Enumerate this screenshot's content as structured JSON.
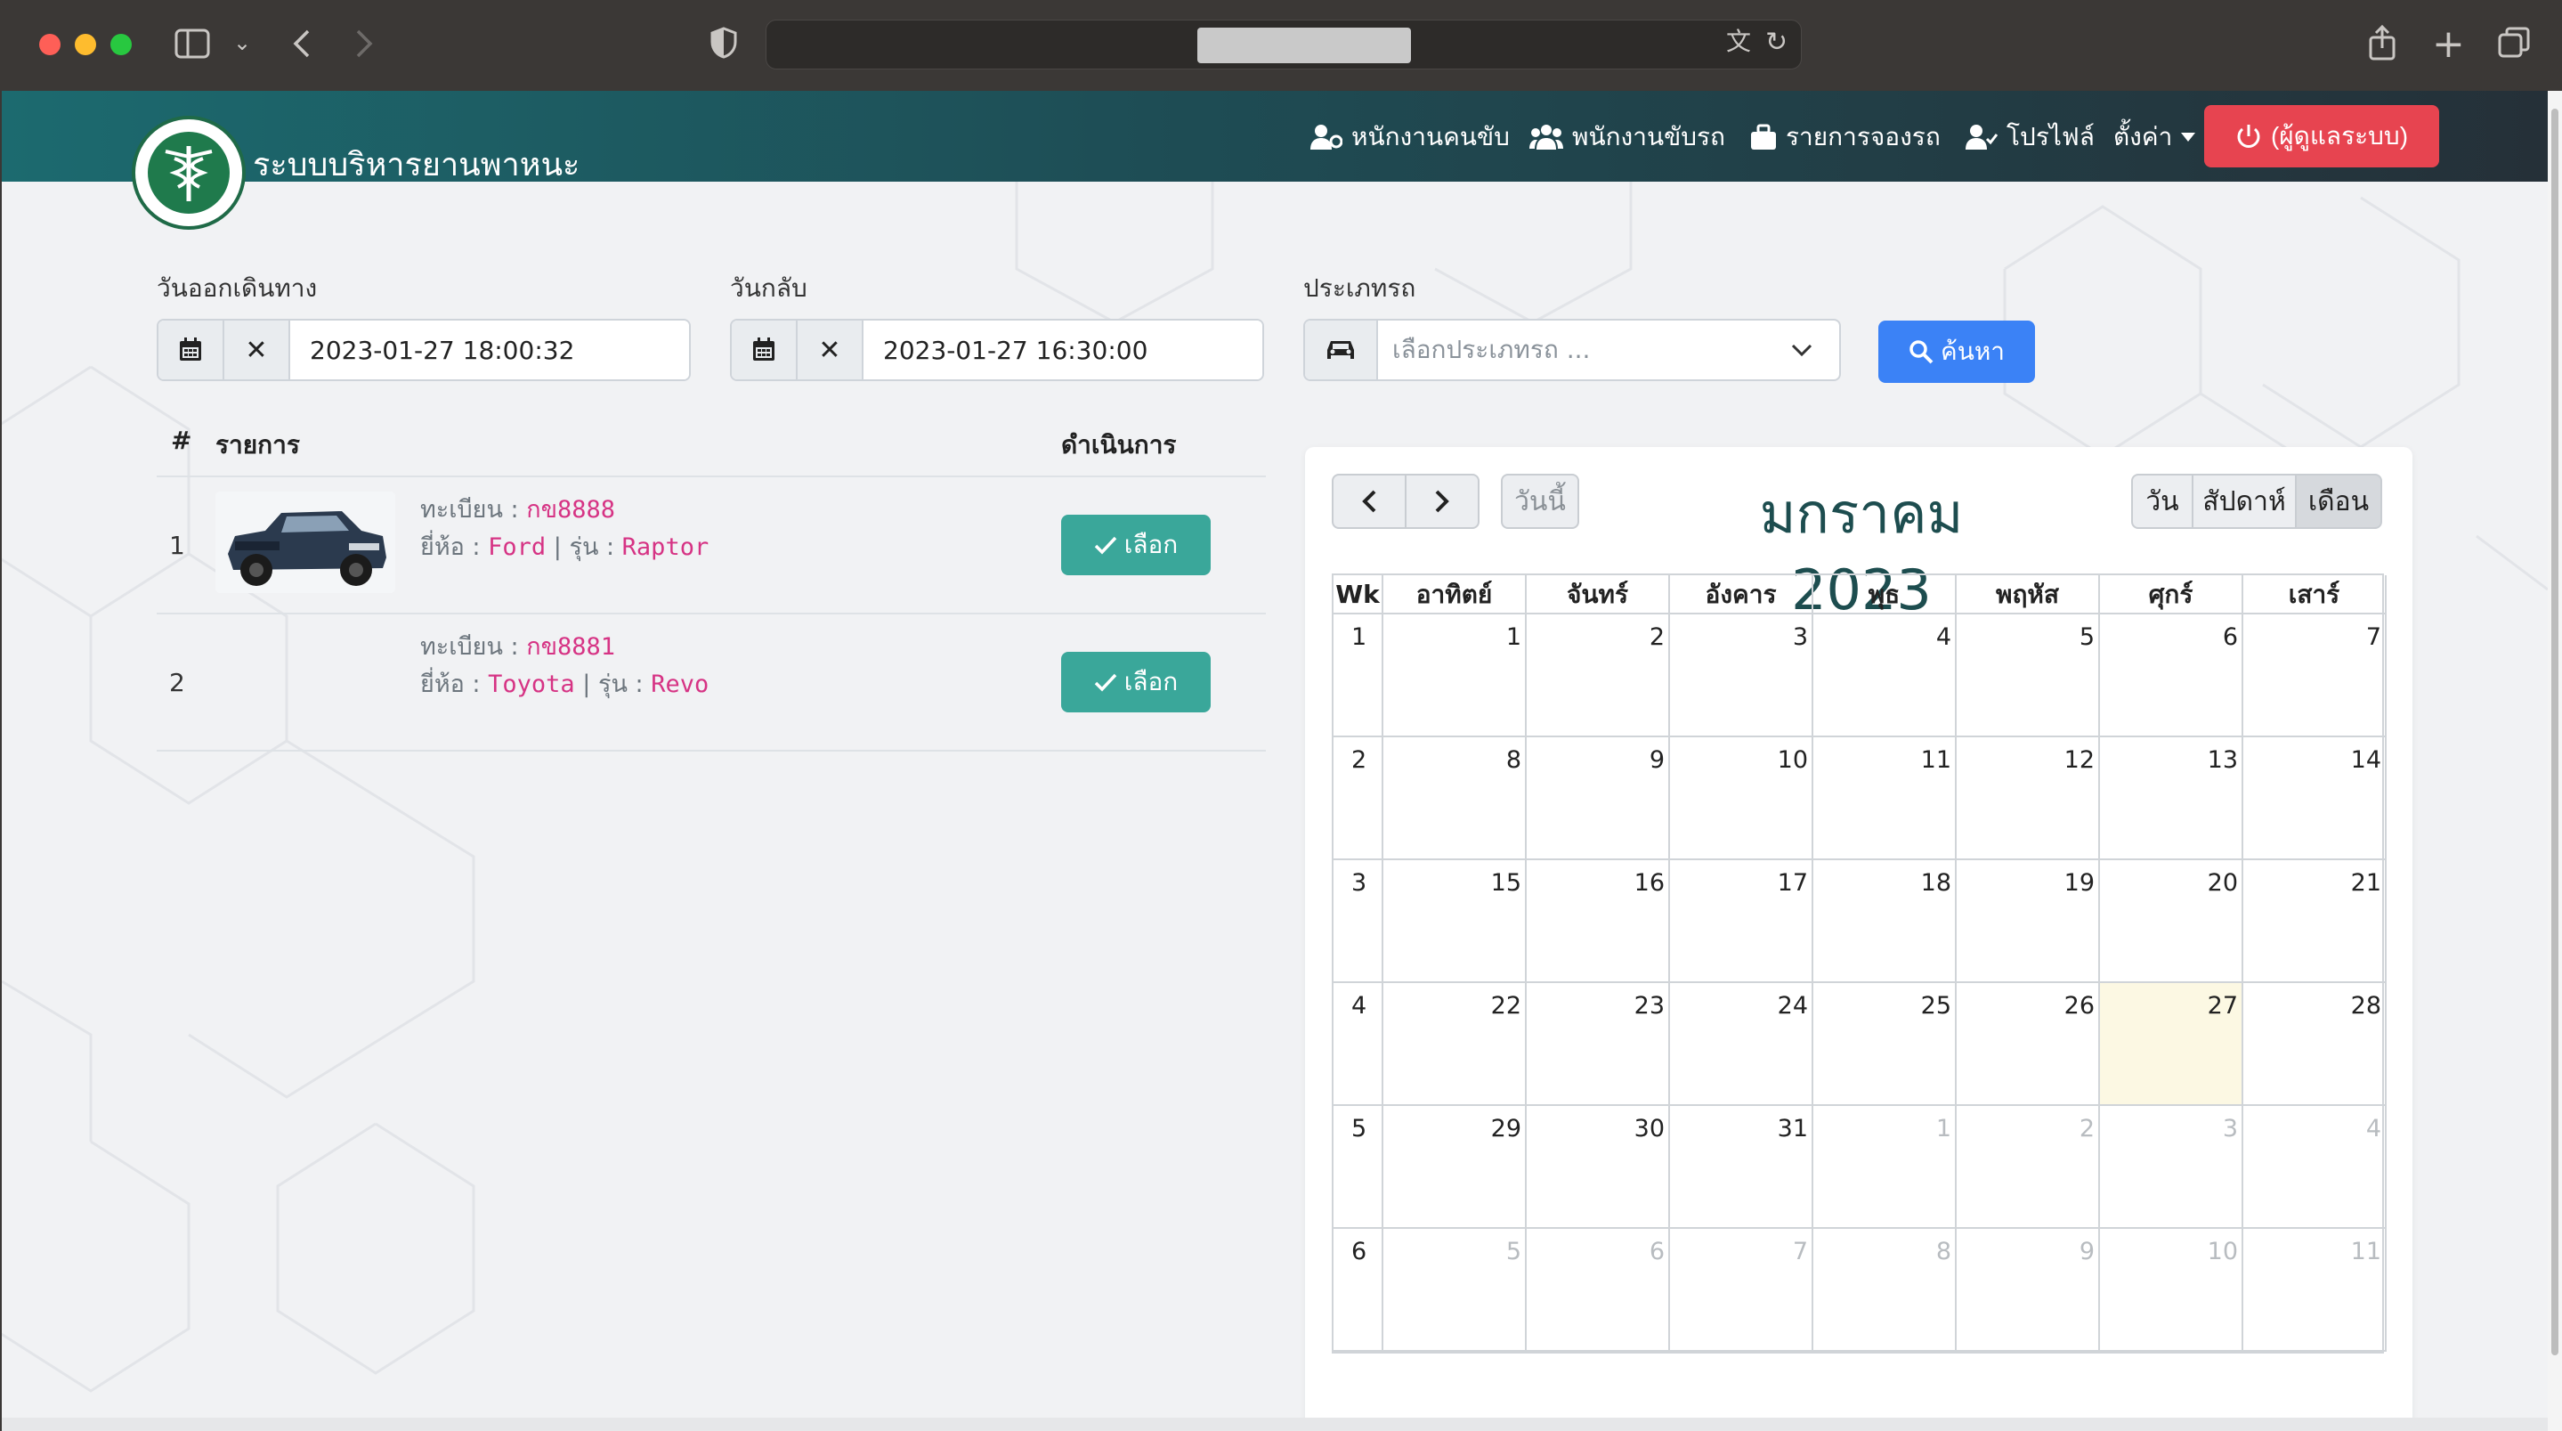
{
  "browser": {
    "address": ""
  },
  "navbar": {
    "brand": "ระบบบริหารยานพาหนะ",
    "items": [
      {
        "label": "หนักงานคนขับ",
        "icon": "users-cog-icon"
      },
      {
        "label": "พนักงานขับรถ",
        "icon": "users-icon"
      },
      {
        "label": "รายการจองรถ",
        "icon": "briefcase-icon"
      },
      {
        "label": "โปรไฟล์",
        "icon": "user-check-icon"
      },
      {
        "label": "ตั้งค่า",
        "icon": "caret-down-icon"
      }
    ],
    "logout": "(ผู้ดูแลระบบ)"
  },
  "form": {
    "depart_label": "วันออกเดินทาง",
    "depart_value": "2023-01-27 18:00:32",
    "return_label": "วันกลับ",
    "return_value": "2023-01-27 16:30:00",
    "type_label": "ประเภทรถ",
    "type_placeholder": "เลือกประเภทรถ ...",
    "search_label": "ค้นหา"
  },
  "table": {
    "col_num": "#",
    "col_item": "รายการ",
    "col_action": "ดำเนินการ",
    "rows": [
      {
        "num": "1",
        "plate_label": "ทะเบียน :",
        "plate": "กข8888",
        "brand_label": "ยี่ห้อ :",
        "brand": "Ford",
        "sep": "|",
        "model_label": "รุ่น :",
        "model": "Raptor",
        "action": "เลือก"
      },
      {
        "num": "2",
        "plate_label": "ทะเบียน :",
        "plate": "กข8881",
        "brand_label": "ยี่ห้อ :",
        "brand": "Toyota",
        "sep": "|",
        "model_label": "รุ่น :",
        "model": "Revo",
        "action": "เลือก"
      }
    ]
  },
  "calendar": {
    "title": "มกราคม 2023",
    "today_btn": "วันนี้",
    "views": [
      "วัน",
      "สัปดาห์",
      "เดือน"
    ],
    "active_view": "เดือน",
    "headers": [
      "Wk",
      "อาทิตย์",
      "จันทร์",
      "อังคาร",
      "พุธ",
      "พฤหัส",
      "ศุกร์",
      "เสาร์"
    ],
    "weeks": [
      {
        "wk": "1",
        "days": [
          "1",
          "2",
          "3",
          "4",
          "5",
          "6",
          "7"
        ]
      },
      {
        "wk": "2",
        "days": [
          "8",
          "9",
          "10",
          "11",
          "12",
          "13",
          "14"
        ]
      },
      {
        "wk": "3",
        "days": [
          "15",
          "16",
          "17",
          "18",
          "19",
          "20",
          "21"
        ]
      },
      {
        "wk": "4",
        "days": [
          "22",
          "23",
          "24",
          "25",
          "26",
          "27",
          "28"
        ]
      },
      {
        "wk": "5",
        "days": [
          "29",
          "30",
          "31",
          "1",
          "2",
          "3",
          "4"
        ]
      },
      {
        "wk": "6",
        "days": [
          "5",
          "6",
          "7",
          "8",
          "9",
          "10",
          "11"
        ]
      }
    ],
    "today": "27",
    "today_color": "#fcf8e3"
  }
}
